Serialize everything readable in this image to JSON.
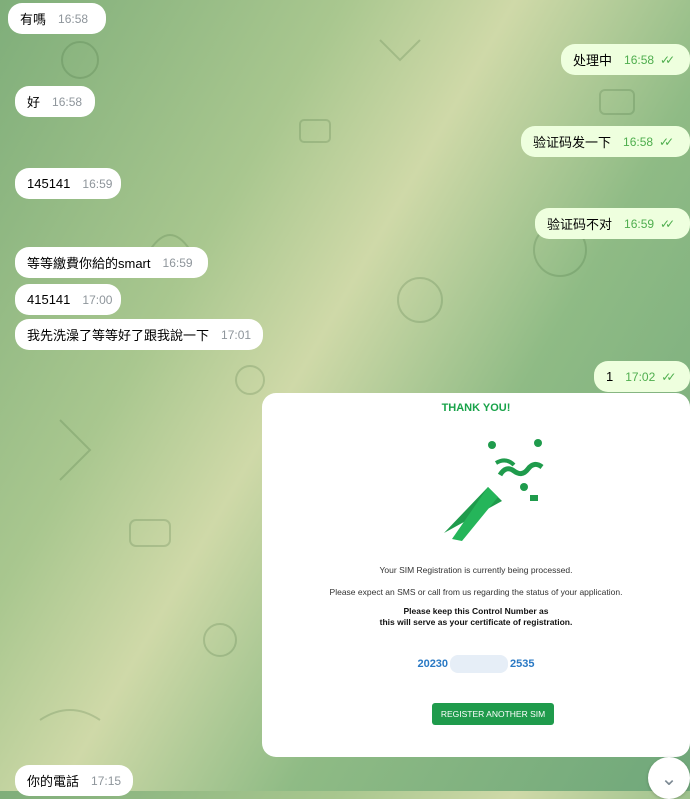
{
  "messages": [
    {
      "side": "in",
      "text": "有嗎",
      "time": "16:58"
    },
    {
      "side": "out",
      "text": "处理中",
      "time": "16:58"
    },
    {
      "side": "in",
      "text": "好",
      "time": "16:58"
    },
    {
      "side": "out",
      "text": "验证码发一下",
      "time": "16:58"
    },
    {
      "side": "in",
      "text": "145141",
      "time": "16:59"
    },
    {
      "side": "out",
      "text": "验证码不对",
      "time": "16:59"
    },
    {
      "side": "in",
      "text": "等等繳費你給的smart",
      "time": "16:59"
    },
    {
      "side": "in",
      "text": "415141",
      "time": "17:00"
    },
    {
      "side": "in",
      "text": "我先洗澡了等等好了跟我說一下",
      "time": "17:01"
    },
    {
      "side": "out",
      "text": "1",
      "time": "17:02"
    },
    {
      "side": "in",
      "text": "你的電話",
      "time": "17:15"
    }
  ],
  "card": {
    "title": "THANK YOU!",
    "line1": "Your SIM Registration is currently being processed.",
    "line2": "Please expect an SMS or call from us regarding the status of your application.",
    "line3": "Please keep this Control Number as",
    "line4": "this will serve as your certificate of registration.",
    "control_prefix": "20230",
    "control_suffix": "2535",
    "button": "REGISTER ANOTHER SIM"
  },
  "icons": {
    "read_ticks": "double-check-icon",
    "scroll": "chevron-down-icon"
  },
  "colors": {
    "incoming": "#ffffff",
    "outgoing": "#eeffde",
    "accent_green": "#19a34a",
    "control_blue": "#2a79c4"
  }
}
